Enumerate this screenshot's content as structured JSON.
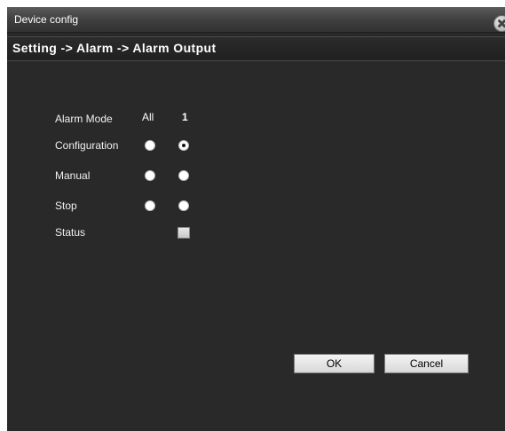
{
  "window": {
    "title": "Device config"
  },
  "breadcrumb": "Setting -> Alarm -> Alarm Output",
  "columns": {
    "all": "All",
    "one": "1"
  },
  "rows": [
    {
      "label": "Alarm Mode"
    },
    {
      "label": "Configuration",
      "all_checked": false,
      "one_checked": true
    },
    {
      "label": "Manual",
      "all_checked": false,
      "one_checked": false
    },
    {
      "label": "Stop",
      "all_checked": false,
      "one_checked": false
    },
    {
      "label": "Status"
    }
  ],
  "buttons": {
    "ok": "OK",
    "cancel": "Cancel"
  }
}
